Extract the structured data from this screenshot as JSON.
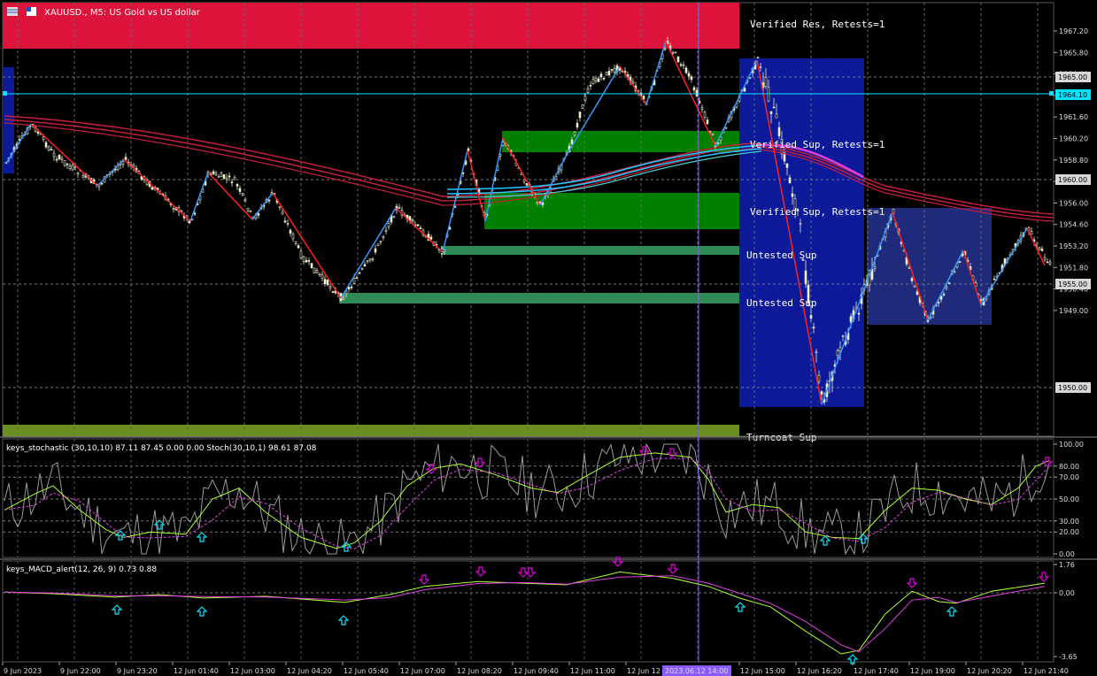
{
  "chart_header": {
    "symbol_title": "XAUUSD., M5:  US Gold vs US dollar"
  },
  "zones": {
    "verified_res_1": "Verified Res, Retests=1",
    "verified_sup_1": "Verified Sup, Retests=1",
    "verified_sup_2": "Verified Sup, Retests=1",
    "untested_sup_1": "Untested Sup",
    "untested_sup_2": "Untested Sup",
    "turncoat_sup": "Turncoat Sup"
  },
  "price_axis": {
    "labels": [
      "1967.20",
      "1965.80",
      "1964.40",
      "1963.00",
      "1961.60",
      "1960.20",
      "1958.80",
      "1957.40",
      "1956.00",
      "1954.60",
      "1953.20",
      "1951.80",
      "1950.40",
      "1949.00"
    ],
    "boxed_labels": [
      "1965.00",
      "1964.10",
      "1960.00",
      "1955.00",
      "1950.00"
    ],
    "current_price": "1964.10"
  },
  "stochastic": {
    "title": "keys_stochastic (30,10,10) 87.11 87.45 0.00 0.00 Stoch(30,10,1) 98.61 87.08",
    "levels": [
      "100.00",
      "80.00",
      "70.00",
      "50.00",
      "30.00",
      "20.00",
      "0.00"
    ]
  },
  "macd": {
    "title": "keys_MACD_alert(12, 26, 9) 0.73 0.88",
    "levels": [
      "1.76",
      "0.00",
      "-3.65"
    ]
  },
  "time_axis": {
    "labels": [
      "9 Jun 2023",
      "9 Jun 22:00",
      "9 Jun 23:20",
      "12 Jun 01:40",
      "12 Jun 03:00",
      "12 Jun 04:20",
      "12 Jun 05:40",
      "12 Jun 07:00",
      "12 Jun 08:20",
      "12 Jun 09:40",
      "12 Jun 11:00",
      "12 Jun 12",
      "12 Jun 15:00",
      "12 Jun 16:20",
      "12 Jun 17:40",
      "12 Jun 19:00",
      "12 Jun 20:20",
      "12 Jun 21:40"
    ],
    "crosshair_time": "2023.06.12 14:00"
  },
  "colors": {
    "background": "#000000",
    "resistance_zone": "#dc143c",
    "support_zone": "#008000",
    "untested_zone": "#2e8b57",
    "turncoat_zone": "#6b8e23",
    "selection_box": "#0c1a9a",
    "selection_box_2": "#1f2a7a",
    "bull_candle": "#f5f5c8",
    "zigzag_up": "#3399ff",
    "zigzag_down": "#ff2020",
    "ma_red": "#c41e3a",
    "ma_cyan": "#1ec8ff",
    "ma_magenta": "#e040e0",
    "crosshair": "#8a5cff",
    "accent_cyan": "#00e5ff",
    "alert_down": "#e000e0"
  }
}
